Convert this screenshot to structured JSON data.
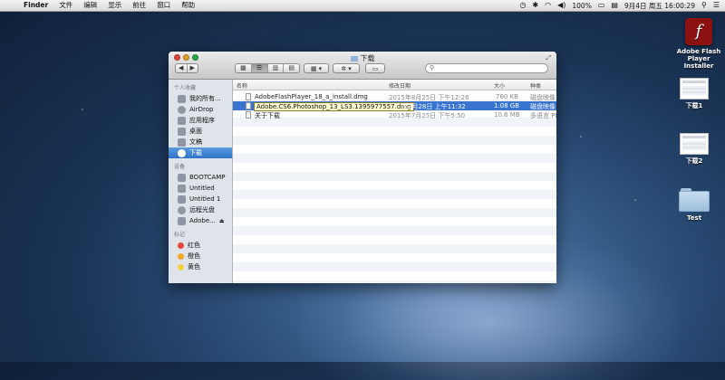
{
  "menubar": {
    "apple": "",
    "items": [
      "Finder",
      "文件",
      "编辑",
      "显示",
      "前往",
      "窗口",
      "帮助"
    ],
    "battery": "100%",
    "clock": "9月4日 周五 16:00:29"
  },
  "desktop_icons": [
    {
      "label": "Adobe Flash Player Installer",
      "glyph": "f"
    },
    {
      "label": "下载1"
    },
    {
      "label": "下载2"
    },
    {
      "label": "Test"
    }
  ],
  "window": {
    "title": "下载",
    "search_placeholder": "",
    "toolbar": {
      "back": "◀",
      "forward": "▶",
      "view_icons": "▦",
      "view_list": "☰",
      "view_columns": "▥",
      "view_coverflow": "▤",
      "arrange": "▦ ▾",
      "action": "✲ ▾",
      "pill": "▭"
    },
    "sidebar": {
      "sections": [
        {
          "title": "个人收藏",
          "items": [
            "我的所有...",
            "AirDrop",
            "应用程序",
            "桌面",
            "文稿",
            "下载"
          ]
        },
        {
          "title": "设备",
          "items": [
            "BOOTCAMP",
            "Untitled",
            "Untitled 1",
            "远程光盘",
            "Adobe..."
          ]
        },
        {
          "title": "标记",
          "items": [
            "红色",
            "橙色",
            "黄色"
          ]
        }
      ],
      "tag_colors": [
        "#e8453c",
        "#f5a623",
        "#f0d33a"
      ]
    },
    "columns": [
      "名称",
      "修改日期",
      "大小",
      "种类"
    ],
    "files": [
      {
        "name": "AdobeFlashPlayer_18_a_install.dmg",
        "date": "2015年8月25日 下午12:26",
        "size": "760 KB",
        "kind": "磁盘映像"
      },
      {
        "name": "Adobe.CS6.Photoshop_13_LS3.1395977557.dmg",
        "date": "年3月28日 上午11:32",
        "size": "1.08 GB",
        "kind": "磁盘映像"
      },
      {
        "name": "关于下载",
        "date": "2015年7月25日 下午5:50",
        "size": "10.6 MB",
        "kind": "多语言 PD"
      }
    ]
  }
}
